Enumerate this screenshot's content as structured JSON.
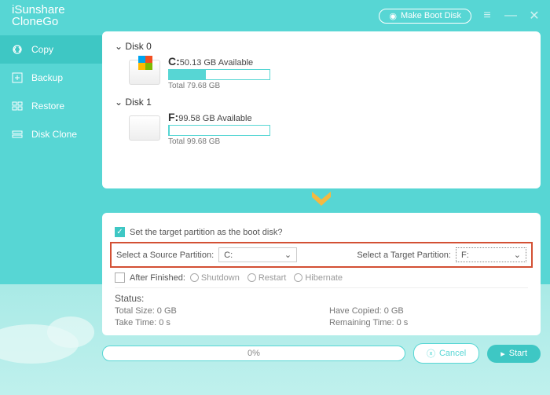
{
  "header": {
    "brand_line1": "iSunshare",
    "brand_line2": "CloneGo",
    "boot_button": "Make Boot Disk"
  },
  "sidebar": {
    "items": [
      {
        "label": "Copy"
      },
      {
        "label": "Backup"
      },
      {
        "label": "Restore"
      },
      {
        "label": "Disk Clone"
      }
    ]
  },
  "disks": [
    {
      "title": "Disk 0",
      "partitions": [
        {
          "letter": "C:",
          "available": "50.13 GB Available",
          "total": "Total 79.68 GB",
          "used_pct": 37
        }
      ]
    },
    {
      "title": "Disk 1",
      "partitions": [
        {
          "letter": "F:",
          "available": "99.58 GB Available",
          "total": "Total 99.68 GB",
          "used_pct": 1
        }
      ]
    }
  ],
  "config": {
    "boot_checkbox_label": "Set the target partition as the boot disk?",
    "source_label": "Select a Source Partition:",
    "source_value": "C:",
    "target_label": "Select a Target Partition:",
    "target_value": "F:",
    "after_label": "After Finished:",
    "radios": [
      "Shutdown",
      "Restart",
      "Hibernate"
    ]
  },
  "status": {
    "header": "Status:",
    "total_size": "Total Size: 0 GB",
    "have_copied": "Have Copied: 0 GB",
    "take_time": "Take Time: 0 s",
    "remaining": "Remaining Time: 0 s"
  },
  "bottom": {
    "progress_pct": "0%",
    "cancel": "Cancel",
    "start": "Start"
  }
}
